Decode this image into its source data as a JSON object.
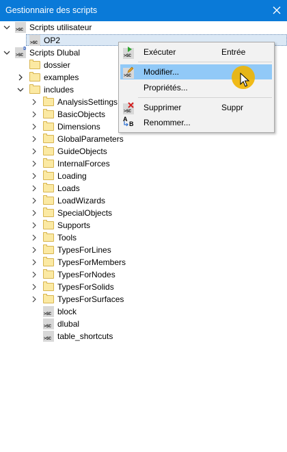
{
  "window": {
    "title": "Gestionnaire des scripts"
  },
  "tree": {
    "user_root": "Scripts utilisateur",
    "user_script": "OP2",
    "dlubal_root": "Scripts Dlubal",
    "dossier": "dossier",
    "examples": "examples",
    "includes": "includes",
    "include_folders": [
      "AnalysisSettings",
      "BasicObjects",
      "Dimensions",
      "GlobalParameters",
      "GuideObjects",
      "InternalForces",
      "Loading",
      "Loads",
      "LoadWizards",
      "SpecialObjects",
      "Supports",
      "Tools",
      "TypesForLines",
      "TypesForMembers",
      "TypesForNodes",
      "TypesForSolids",
      "TypesForSurfaces"
    ],
    "include_files": [
      "block",
      "dlubal",
      "table_shortcuts"
    ]
  },
  "context_menu": {
    "execute": {
      "label": "Exécuter",
      "shortcut": "Entrée"
    },
    "edit": {
      "label": "Modifier..."
    },
    "properties": {
      "label": "Propriétés..."
    },
    "delete": {
      "label": "Supprimer",
      "shortcut": "Suppr"
    },
    "rename": {
      "label": "Renommer..."
    }
  },
  "icons": {
    "script_badge": ">SC",
    "dlubal_badge": "D",
    "rename_a": "A",
    "rename_b": "B"
  },
  "colors": {
    "titlebar": "#0a7ad8",
    "menu_highlight": "#91c9f7",
    "cursor_highlight": "#f0b400"
  }
}
